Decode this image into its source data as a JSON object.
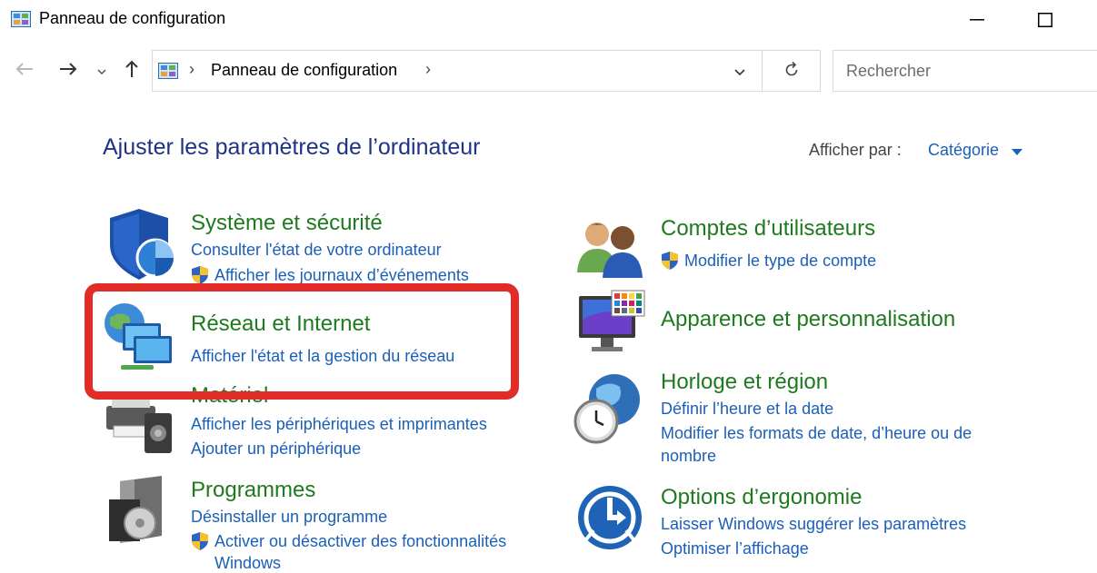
{
  "window": {
    "title": "Panneau de configuration"
  },
  "address_bar": {
    "path": "Panneau de configuration"
  },
  "search": {
    "placeholder": "Rechercher"
  },
  "page_title": "Ajuster les paramètres de l’ordinateur",
  "view_by": {
    "label": "Afficher par :",
    "value": "Catégorie"
  },
  "categories": {
    "system": {
      "title": "Système et sécurité",
      "links": [
        "Consulter l'état de votre ordinateur",
        "Afficher les journaux d’événements"
      ]
    },
    "network": {
      "title": "Réseau et Internet",
      "links": [
        "Afficher l'état et la gestion du réseau"
      ]
    },
    "hardware": {
      "title": "Matériel",
      "links": [
        "Afficher les périphériques et imprimantes",
        "Ajouter un périphérique"
      ]
    },
    "programs": {
      "title": "Programmes",
      "links": [
        "Désinstaller un programme",
        "Activer ou désactiver des fonctionnalités",
        "Windows"
      ]
    },
    "accounts": {
      "title": "Comptes d’utilisateurs",
      "links": [
        "Modifier le type de compte"
      ]
    },
    "appearance": {
      "title": "Apparence et personnalisation",
      "links": []
    },
    "clock": {
      "title": "Horloge et région",
      "links": [
        "Définir l’heure et la date",
        "Modifier les formats de date, d’heure ou de",
        "nombre"
      ]
    },
    "ease": {
      "title": "Options d’ergonomie",
      "links": [
        "Laisser Windows suggérer les paramètres",
        "Optimiser l’affichage"
      ]
    }
  },
  "colors": {
    "category_title": "#1e7a1e",
    "link": "#1b5fb7",
    "page_title": "#1e3287",
    "highlight": "#e12c27"
  },
  "icons": [
    "control-panel-icon",
    "back-arrow-icon",
    "forward-arrow-icon",
    "recent-dropdown-icon",
    "up-arrow-icon",
    "chevron-down-icon",
    "refresh-icon",
    "shield-icon",
    "uac-shield-icon",
    "network-icon",
    "hardware-icon",
    "programs-icon",
    "users-icon",
    "display-icon",
    "clock-globe-icon",
    "ease-of-access-icon"
  ]
}
